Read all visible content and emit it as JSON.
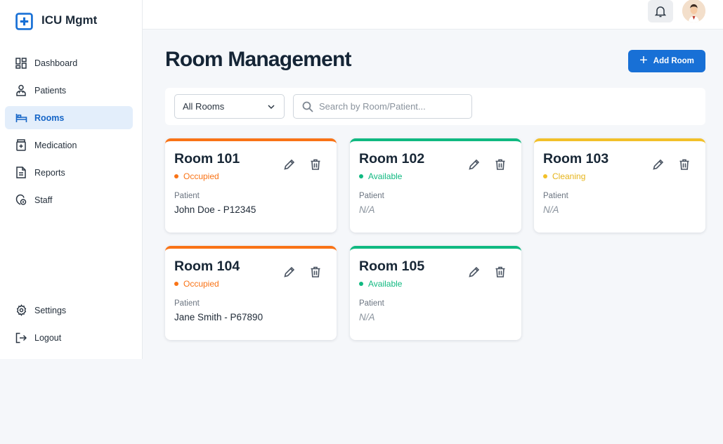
{
  "app": {
    "name": "ICU Mgmt"
  },
  "sidebar": {
    "items": [
      {
        "label": "Dashboard",
        "icon": "dashboard-icon"
      },
      {
        "label": "Patients",
        "icon": "patient-icon"
      },
      {
        "label": "Rooms",
        "icon": "bed-icon",
        "active": true
      },
      {
        "label": "Medication",
        "icon": "medication-icon"
      },
      {
        "label": "Reports",
        "icon": "document-icon"
      },
      {
        "label": "Staff",
        "icon": "staff-icon"
      }
    ],
    "bottom_items": [
      {
        "label": "Settings",
        "icon": "gear-icon"
      },
      {
        "label": "Logout",
        "icon": "logout-icon"
      }
    ]
  },
  "header": {
    "title": "Room Management",
    "add_button_label": "Add Room"
  },
  "filters": {
    "room_filter_value": "All Rooms",
    "room_filter_options": [
      "All Rooms"
    ],
    "search_placeholder": "Search by Room/Patient..."
  },
  "rooms": [
    {
      "name": "Room 101",
      "status": "Occupied",
      "patient_label": "Patient",
      "patient": "John Doe - P12345"
    },
    {
      "name": "Room 102",
      "status": "Available",
      "patient_label": "Patient",
      "patient": "N/A"
    },
    {
      "name": "Room 103",
      "status": "Cleaning",
      "patient_label": "Patient",
      "patient": "N/A"
    },
    {
      "name": "Room 104",
      "status": "Occupied",
      "patient_label": "Patient",
      "patient": "Jane Smith - P67890"
    },
    {
      "name": "Room 105",
      "status": "Available",
      "patient_label": "Patient",
      "patient": "N/A"
    }
  ],
  "colors": {
    "primary": "#1870d6",
    "occupied": "#f97316",
    "available": "#10b981",
    "cleaning": "#f2c029",
    "active_nav_bg": "#e3eefb"
  }
}
